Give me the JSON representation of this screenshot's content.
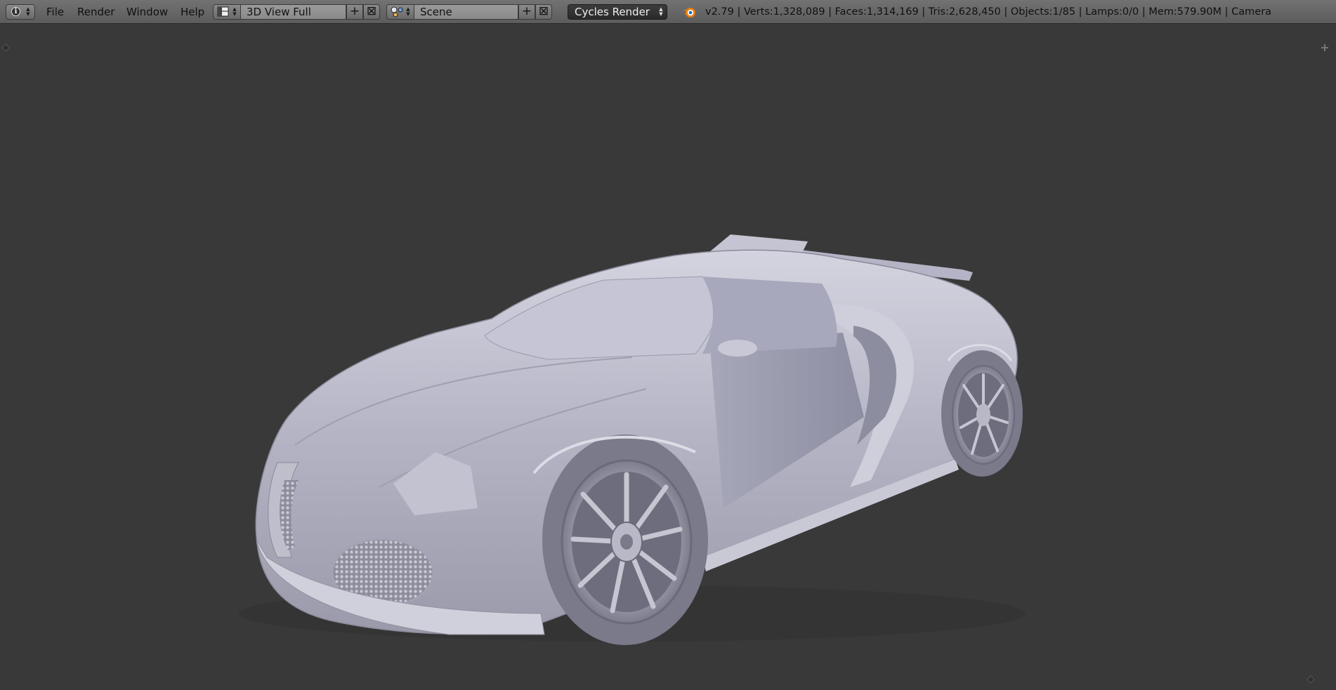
{
  "header": {
    "editor_icon": "info-icon",
    "menu": {
      "file": "File",
      "render": "Render",
      "window": "Window",
      "help": "Help"
    },
    "screen_layout": {
      "icon": "screen-layout-icon",
      "name": "3D View Full"
    },
    "scene": {
      "icon": "scene-icon",
      "name": "Scene"
    },
    "render_engine": "Cycles Render",
    "stats": "v2.79 | Verts:1,328,089 | Faces:1,314,169 | Tris:2,628,450 | Objects:1/85 | Lamps:0/0 | Mem:579.90M | Camera"
  },
  "viewport": {
    "background": "#393939",
    "model_color": "#b9b9c9"
  }
}
